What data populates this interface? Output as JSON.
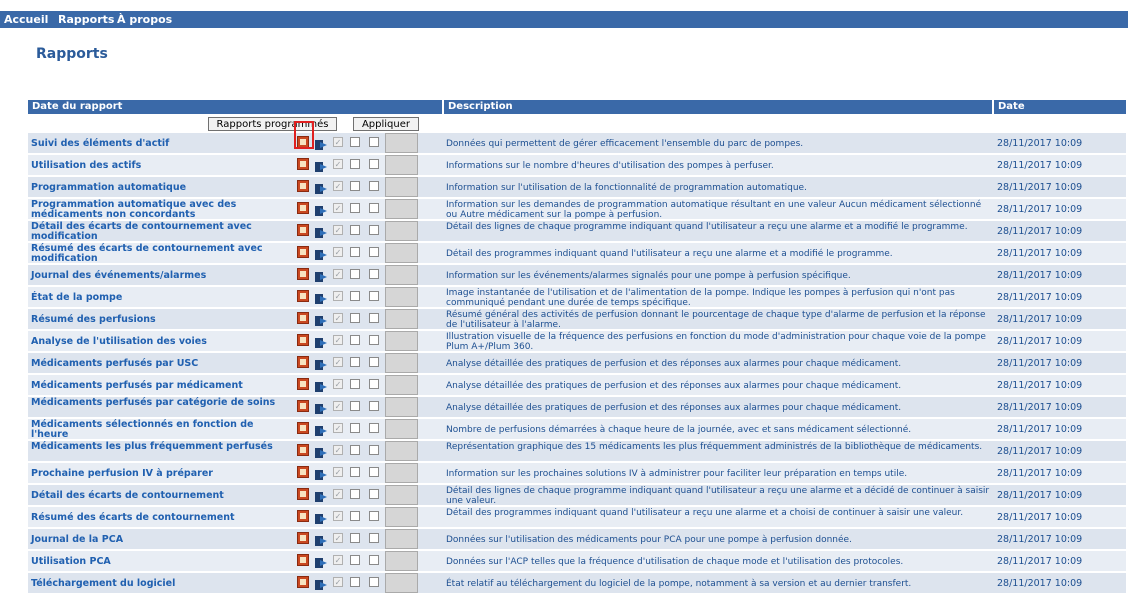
{
  "nav": {
    "items": [
      "Accueil",
      "Rapports",
      "À propos"
    ]
  },
  "page": {
    "title": "Rapports"
  },
  "table": {
    "headers": {
      "report": "Date du rapport",
      "description": "Description",
      "date": "Date"
    },
    "controls": {
      "scheduled_label": "Rapports programmés",
      "apply_label": "Appliquer"
    },
    "rows": [
      {
        "name": "Suivi des éléments d'actif",
        "description": "Données qui permettent de gérer efficacement l'ensemble du parc de pompes.",
        "date": "28/11/2017 10:09"
      },
      {
        "name": "Utilisation des actifs",
        "description": "Informations sur le nombre d'heures d'utilisation des pompes à perfuser.",
        "date": "28/11/2017 10:09"
      },
      {
        "name": "Programmation automatique",
        "description": "Information sur l'utilisation de la fonctionnalité de programmation automatique.",
        "date": "28/11/2017 10:09"
      },
      {
        "name": "Programmation automatique avec des médicaments non concordants",
        "description": "Information sur les demandes de programmation automatique résultant en une valeur Aucun médicament sélectionné ou Autre médicament sur la pompe à perfusion.",
        "date": "28/11/2017 10:09"
      },
      {
        "name": "Détail des écarts de contournement avec modification",
        "description": "Détail des lignes de chaque programme indiquant quand l'utilisateur a reçu une alarme et a modifié le programme.",
        "date": "28/11/2017 10:09"
      },
      {
        "name": "Résumé des écarts de contournement avec modification",
        "description": "Détail des programmes indiquant quand l'utilisateur a reçu une alarme et a modifié le programme.",
        "date": "28/11/2017 10:09"
      },
      {
        "name": "Journal des événements/alarmes",
        "description": "Information sur les événements/alarmes signalés pour une pompe à perfusion spécifique.",
        "date": "28/11/2017 10:09"
      },
      {
        "name": "État de la pompe",
        "description": "Image instantanée de l'utilisation et de l'alimentation de la pompe. Indique les pompes à perfusion qui n'ont pas communiqué pendant une durée de temps spécifique.",
        "date": "28/11/2017 10:09"
      },
      {
        "name": "Résumé des perfusions",
        "description": "Résumé général des activités de perfusion donnant le pourcentage de chaque type d'alarme de perfusion et la réponse de l'utilisateur à l'alarme.",
        "date": "28/11/2017 10:09"
      },
      {
        "name": "Analyse de l'utilisation des voies",
        "description": "Illustration visuelle de la fréquence des perfusions en fonction du mode d'administration pour chaque voie de la pompe Plum A+/Plum 360.",
        "date": "28/11/2017 10:09"
      },
      {
        "name": "Médicaments perfusés par USC",
        "description": "Analyse détaillée des pratiques de perfusion et des réponses aux alarmes pour chaque médicament.",
        "date": "28/11/2017 10:09"
      },
      {
        "name": "Médicaments perfusés par médicament",
        "description": "Analyse détaillée des pratiques de perfusion et des réponses aux alarmes pour chaque médicament.",
        "date": "28/11/2017 10:09"
      },
      {
        "name": "Médicaments perfusés par catégorie de soins",
        "description": "Analyse détaillée des pratiques de perfusion et des réponses aux alarmes pour chaque médicament.",
        "date": "28/11/2017 10:09"
      },
      {
        "name": "Médicaments sélectionnés en fonction de l'heure",
        "description": "Nombre de perfusions démarrées à chaque heure de la journée, avec et sans médicament sélectionné.",
        "date": "28/11/2017 10:09"
      },
      {
        "name": "Médicaments les plus fréquemment perfusés",
        "description": "Représentation graphique des 15 médicaments les plus fréquemment administrés de la bibliothèque de médicaments.",
        "date": "28/11/2017 10:09"
      },
      {
        "name": "Prochaine perfusion IV à préparer",
        "description": "Information sur les prochaines solutions IV à administrer pour faciliter leur préparation en temps utile.",
        "date": "28/11/2017 10:09"
      },
      {
        "name": "Détail des écarts de contournement",
        "description": "Détail des lignes de chaque programme indiquant quand l'utilisateur a reçu une alarme et a décidé de continuer à saisir une valeur.",
        "date": "28/11/2017 10:09"
      },
      {
        "name": "Résumé des écarts de contournement",
        "description": "Détail des programmes indiquant quand l'utilisateur a reçu une alarme et a choisi de continuer à saisir une valeur.",
        "date": "28/11/2017 10:09"
      },
      {
        "name": "Journal de la PCA",
        "description": "Données sur l'utilisation des médicaments pour PCA pour une pompe à perfusion donnée.",
        "date": "28/11/2017 10:09"
      },
      {
        "name": "Utilisation PCA",
        "description": "Données sur l'ACP telles que la fréquence d'utilisation de chaque mode et l'utilisation des protocoles.",
        "date": "28/11/2017 10:09"
      },
      {
        "name": "Téléchargement du logiciel",
        "description": "État relatif au téléchargement du logiciel de la pompe, notamment à sa version et au dernier transfert.",
        "date": "28/11/2017 10:09"
      }
    ]
  }
}
